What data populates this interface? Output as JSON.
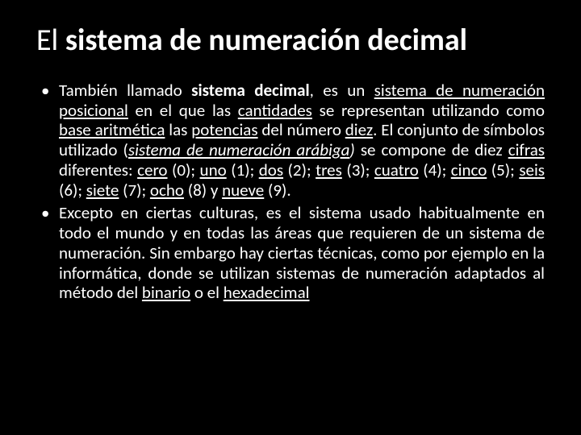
{
  "title": {
    "pre": "El ",
    "bold": "sistema de numeración decimal"
  },
  "bullets": [
    {
      "segments": [
        {
          "t": "También llamado "
        },
        {
          "t": "sistema decimal",
          "cls": "b"
        },
        {
          "t": ", es un "
        },
        {
          "t": "sistema de numeración posicional",
          "cls": "u"
        },
        {
          "t": " en el que las "
        },
        {
          "t": "cantidades",
          "cls": "u"
        },
        {
          "t": " se representan utilizando como "
        },
        {
          "t": "base aritmética",
          "cls": "u"
        },
        {
          "t": " las "
        },
        {
          "t": "potencias",
          "cls": "u"
        },
        {
          "t": " del número "
        },
        {
          "t": "diez",
          "cls": "u"
        },
        {
          "t": ". El conjunto de símbolos utilizado ("
        },
        {
          "t": "sistema de numeración arábiga",
          "cls": "i u"
        },
        {
          "t": ")",
          "cls": "i"
        },
        {
          "t": " se compone de diez "
        },
        {
          "t": "cifras",
          "cls": "u"
        },
        {
          "t": " diferentes: "
        },
        {
          "t": "cero",
          "cls": "u"
        },
        {
          "t": " (0); "
        },
        {
          "t": "uno",
          "cls": "u"
        },
        {
          "t": " (1); "
        },
        {
          "t": "dos",
          "cls": "u"
        },
        {
          "t": " (2); "
        },
        {
          "t": "tres",
          "cls": "u"
        },
        {
          "t": " (3); "
        },
        {
          "t": "cuatro",
          "cls": "u"
        },
        {
          "t": " (4); "
        },
        {
          "t": "cinco",
          "cls": "u"
        },
        {
          "t": " (5); "
        },
        {
          "t": "seis",
          "cls": "u"
        },
        {
          "t": " (6); "
        },
        {
          "t": "siete",
          "cls": "u"
        },
        {
          "t": " (7); "
        },
        {
          "t": "ocho",
          "cls": "u"
        },
        {
          "t": " (8) y "
        },
        {
          "t": "nueve",
          "cls": "u"
        },
        {
          "t": " (9)."
        }
      ]
    },
    {
      "segments": [
        {
          "t": "Excepto en ciertas culturas, es el sistema usado habitualmente en todo el mundo y en todas las áreas que requieren de un sistema de numeración. Sin embargo hay ciertas técnicas, como por ejemplo en la informática, donde se utilizan sistemas de numeración adaptados al método del "
        },
        {
          "t": "binario",
          "cls": "u"
        },
        {
          "t": " o el "
        },
        {
          "t": "hexadecimal",
          "cls": "u"
        }
      ]
    }
  ]
}
